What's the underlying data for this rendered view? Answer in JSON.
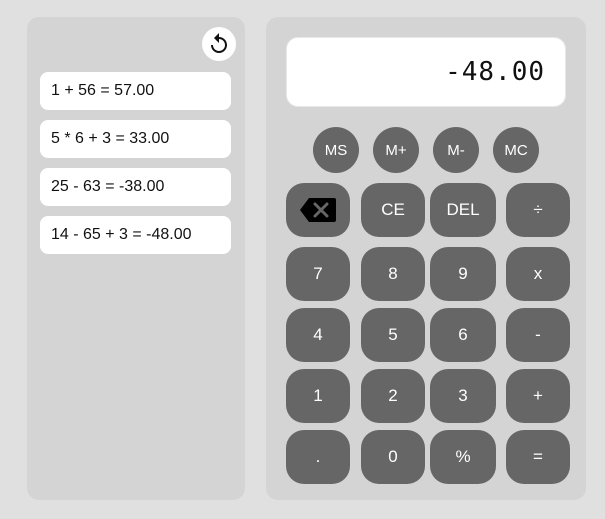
{
  "history": {
    "reset_icon": "undo-icon",
    "items": [
      {
        "expression": "1 + 56 = 57.00"
      },
      {
        "expression": "5 * 6 + 3 = 33.00"
      },
      {
        "expression": "25 - 63 = -38.00"
      },
      {
        "expression": "14 - 65 + 3 = -48.00"
      }
    ]
  },
  "display": {
    "value": "-48.00"
  },
  "memory": {
    "ms": "MS",
    "mplus": "M+",
    "mminus": "M-",
    "mc": "MC"
  },
  "keys": {
    "backspace_icon": "backspace-icon",
    "ce": "CE",
    "del": "DEL",
    "divide": "÷",
    "seven": "7",
    "eight": "8",
    "nine": "9",
    "multiply": "x",
    "four": "4",
    "five": "5",
    "six": "6",
    "minus": "-",
    "one": "1",
    "two": "2",
    "three": "3",
    "plus": "+",
    "dot": ".",
    "zero": "0",
    "percent": "%",
    "equals": "="
  },
  "colors": {
    "background": "#e0e0e0",
    "panel": "#d4d4d4",
    "button": "#666666",
    "button_text": "#ffffff"
  }
}
